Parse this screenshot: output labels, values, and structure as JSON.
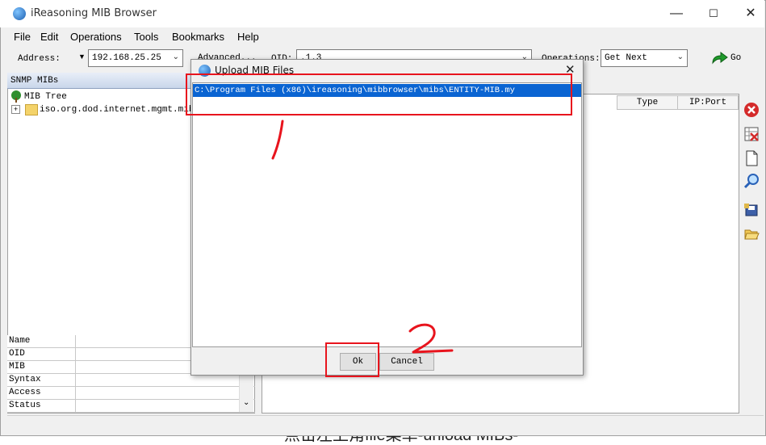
{
  "window": {
    "title": "iReasoning MIB Browser",
    "controls": {
      "minimize": "—",
      "maximize": "☐",
      "close": "✕"
    }
  },
  "menu": [
    "File",
    "Edit",
    "Operations",
    "Tools",
    "Bookmarks",
    "Help"
  ],
  "toolbar": {
    "address_label": "Address:",
    "address_value": "192.168.25.25",
    "advanced_label": "Advanced...",
    "oid_label": "OID:",
    "oid_value": ".1.3",
    "operations_label": "Operations:",
    "operations_value": "Get Next",
    "go_label": "Go"
  },
  "left_panel": {
    "header": "SNMP MIBs",
    "tree_root": "MIB Tree",
    "tree_child": "iso.org.dod.internet.mgmt.mib-2"
  },
  "properties": [
    "Name",
    "OID",
    "MIB",
    "Syntax",
    "Access",
    "Status"
  ],
  "result_columns": [
    "Type",
    "IP:Port"
  ],
  "dialog": {
    "title": "Upload MIB Files",
    "file_path": "C:\\Program Files (x86)\\ireasoning\\mibbrowser\\mibs\\ENTITY-MIB.my",
    "ok_label": "Ok",
    "cancel_label": "Cancel"
  },
  "background_text": "点击左上角file菜单-unload MIBs-",
  "colors": {
    "selection": "#0a64d2",
    "annotation": "#e8141d"
  },
  "icons": [
    "globe-icon",
    "tree-icon",
    "folder-icon",
    "go-arrow-icon",
    "delete-icon",
    "clear-icon",
    "document-icon",
    "find-icon",
    "save-icon",
    "open-folder-icon"
  ]
}
